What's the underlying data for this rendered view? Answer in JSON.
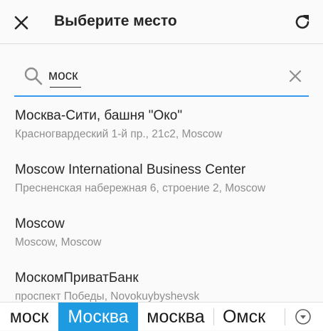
{
  "header": {
    "title": "Выберите место",
    "close_icon": "close-icon",
    "refresh_icon": "refresh-icon"
  },
  "search": {
    "value": "моск",
    "placeholder": "",
    "search_icon": "search-icon",
    "clear_icon": "clear-icon",
    "accent_color": "#3897f0"
  },
  "results": [
    {
      "name": "Москва-Сити, башня \"Око\"",
      "address": "Красногвардеский 1-й пр., 21с2, Moscow"
    },
    {
      "name": "Moscow International Business Center",
      "address": "Пресненская набережная 6, строение 2, Moscow"
    },
    {
      "name": "Moscow",
      "address": "Moscow, Moscow"
    },
    {
      "name": "МоскомПриватБанк",
      "address": "проспект Победы, Novokuybyshevsk"
    }
  ],
  "keyboard_suggestions": {
    "items": [
      "моск",
      "Москва",
      "москва",
      "Омск"
    ],
    "selected": "Москва",
    "selected_color": "#1e9ae0",
    "expand_icon": "chevron-down-icon"
  }
}
